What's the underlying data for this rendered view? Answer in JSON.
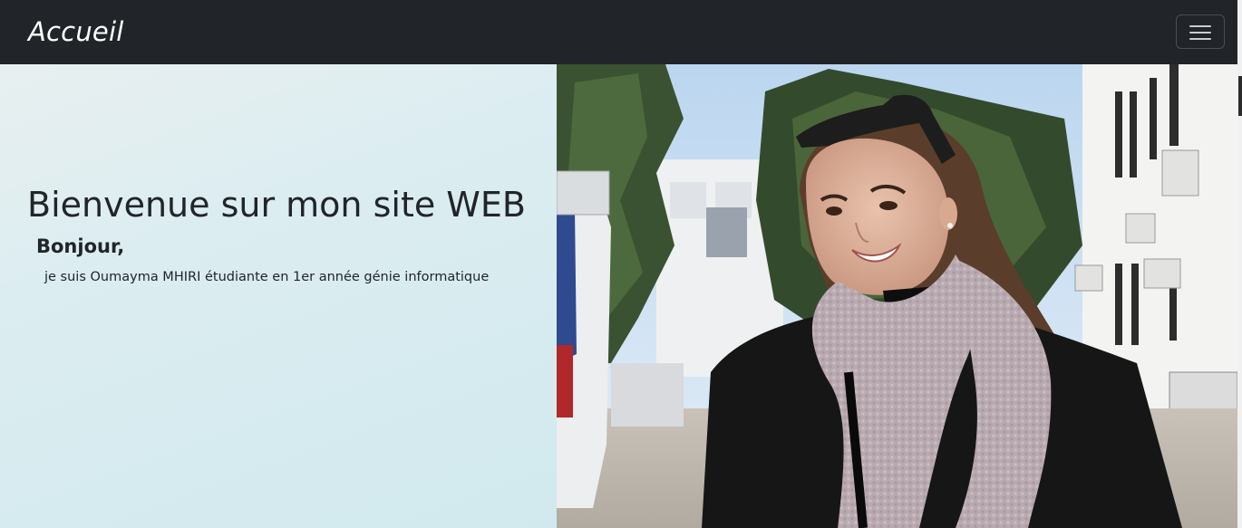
{
  "navbar": {
    "brand": "Accueil",
    "toggler_icon": "hamburger-menu-icon",
    "background_color": "#212529"
  },
  "hero": {
    "title": "Bienvenue sur mon site WEB",
    "subtitle": "Bonjour,",
    "text": "je suis Oumayma MHIRI étudiante en 1er année génie informatique",
    "photo_alt": "portrait-photo"
  }
}
